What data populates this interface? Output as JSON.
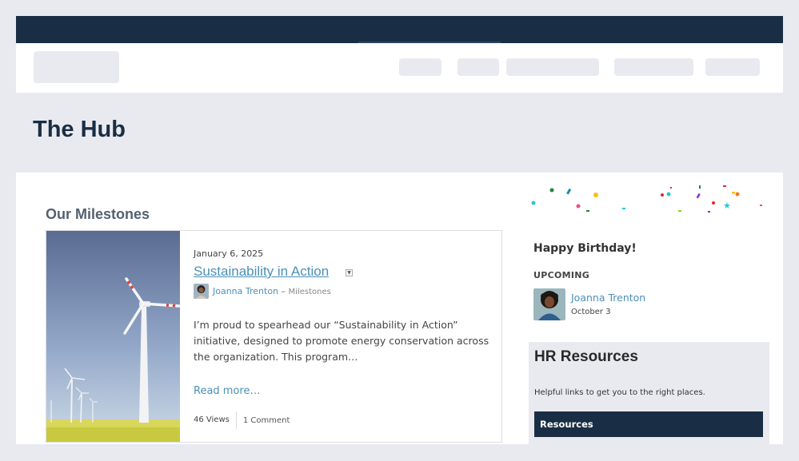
{
  "page": {
    "title": "The Hub"
  },
  "colors": {
    "top_bar": "#192e45",
    "link": "#4a90b8",
    "panel_bg": "#e9eaf0"
  },
  "milestones": {
    "heading": "Our Milestones",
    "post": {
      "date": "January 6, 2025",
      "title": "Sustainability in Action",
      "author": "Joanna Trenton",
      "separator": "–",
      "category": "Milestones",
      "excerpt": "I’m proud to spearhead our “Sustainability in Action” initiative, designed to promote energy conservation across the organization. This program…",
      "read_more": "Read more…",
      "views": "46 Views",
      "comments": "1 Comment"
    }
  },
  "birthday": {
    "title": "Happy Birthday!",
    "upcoming_label": "UPCOMING",
    "person_name": "Joanna Trenton",
    "person_date": "October 3"
  },
  "hr_resources": {
    "title": "HR Resources",
    "subtitle": "Helpful links to get you to the right places.",
    "button_label": "Resources"
  }
}
